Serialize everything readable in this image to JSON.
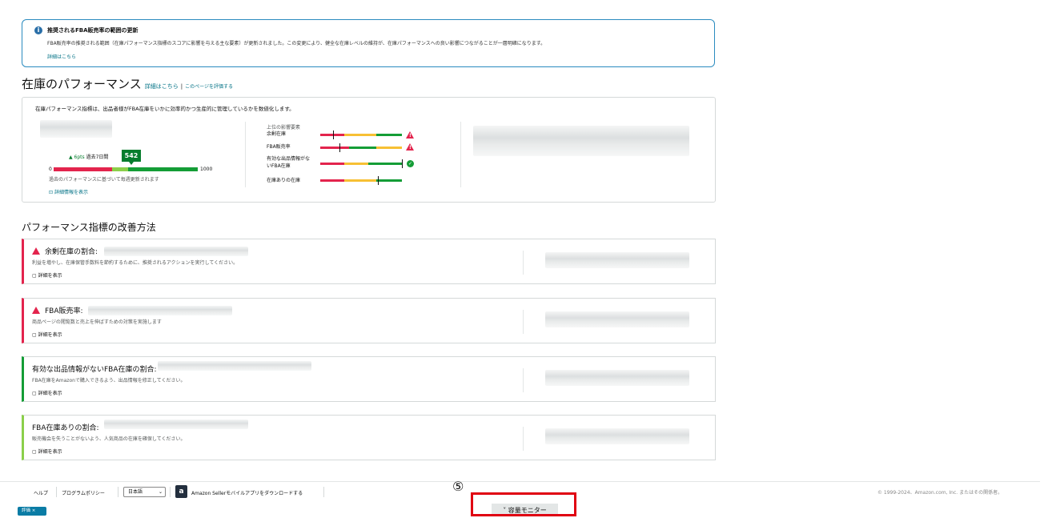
{
  "banner": {
    "icon": "info-icon",
    "title": "推奨されるFBA販売率の範囲の更新",
    "body": "FBA販売率の推奨される範囲（在庫パフォーマンス指標のスコアに影響を与える主な要素）が更新されました。この変更により、健全な在庫レベルの維持が、在庫パフォーマンスへの良い影響につながることが一層明確になります。",
    "link": "詳細はこちら"
  },
  "header": {
    "title": "在庫のパフォーマンス",
    "details_link": "詳細はこちら",
    "separator": "|",
    "rate_link": "このページを評価する"
  },
  "score_card": {
    "description": "在庫パフォーマンス指標は、出品者様がFBA在庫をいかに効率的かつ生産的に管理しているかを数値化します。",
    "score": "542",
    "trend_value": "6pts",
    "trend_period": "過去7日間",
    "min": "0",
    "max": "1000",
    "updated_note": "過去のパフォーマンスに基づいて毎週更新されます",
    "details_link": "詳細情報を表示",
    "factors_heading": "上位の影響要素",
    "factors": [
      {
        "label_line1": "余剰在庫",
        "label_line2": "",
        "status": "warning-icon"
      },
      {
        "label_line1": "FBA販売率",
        "label_line2": "",
        "status": "warning-icon"
      },
      {
        "label_line1": "有効な出品情報がな",
        "label_line2": "いFBA在庫",
        "status": "check-icon"
      },
      {
        "label_line1": "在庫ありの在庫",
        "label_line2": "",
        "status": ""
      }
    ]
  },
  "improve": {
    "heading": "パフォーマンス指標の改善方法",
    "show_details": "詳細を表示",
    "items": [
      {
        "title": "余剰在庫の割合:",
        "desc": "利益を増やし、在庫保管手数料を節約するために、推奨されるアクションを実行してください。",
        "border": "#e3244d",
        "warn": true
      },
      {
        "title": "FBA販売率:",
        "desc": "商品ページの閲覧数と売上を伸ばすための対策を実施します",
        "border": "#e3244d",
        "warn": true
      },
      {
        "title": "有効な出品情報がないFBA在庫の割合:",
        "desc": "FBA在庫をAmazonで購入できるよう、出品情報を修正してください。",
        "border": "#149d36",
        "warn": false
      },
      {
        "title": "FBA在庫ありの割合:",
        "desc": "販売機会を失うことがないよう、人気商品の在庫を確保してください。",
        "border": "#8bcf4a",
        "warn": false
      }
    ]
  },
  "footer": {
    "help": "ヘルプ",
    "policy": "プログラムポリシー",
    "language": "日本語",
    "app_link": "Amazon Sellerモバイルアプリをダウンロードする",
    "copyright": "© 1999-2024、Amazon.com, Inc. またはその関係者。",
    "monitor": "容量モニター",
    "monitor_chevron": "˅",
    "annotation_number": "⑤",
    "tag": "評価 ×"
  }
}
